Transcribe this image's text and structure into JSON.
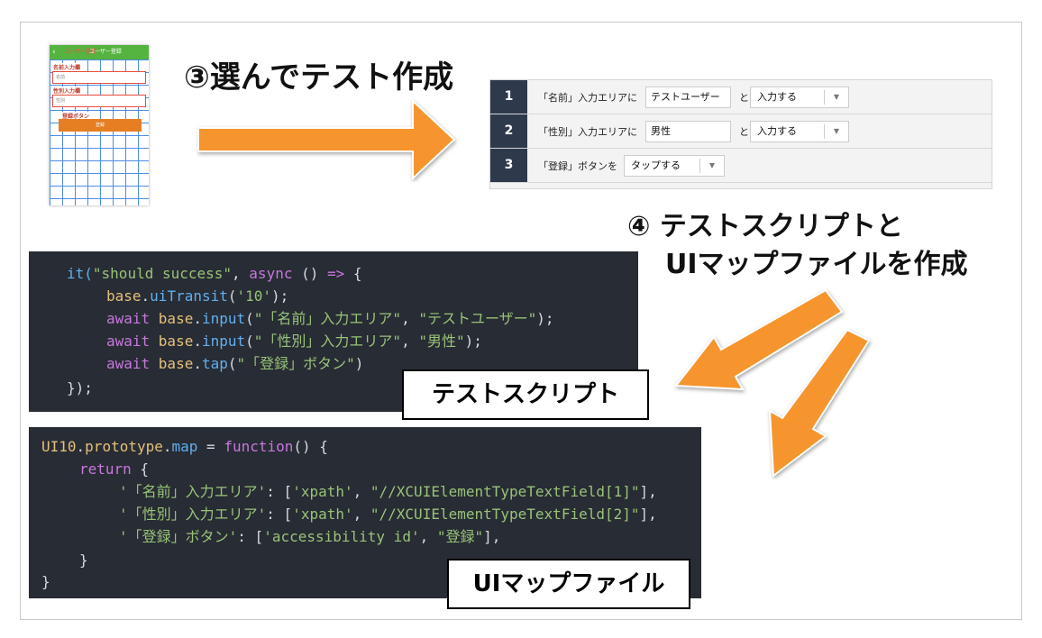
{
  "colors": {
    "arrow": "#f6952e",
    "code_bg": "#282c34",
    "phone_nav": "#55b33f",
    "step_number_bg": "#2e3a4c"
  },
  "phone": {
    "back": "‹",
    "nav_title": "ユーザー登録",
    "nav_sub": "ユーザー登録",
    "name_label": "名前入力欄",
    "name_placeholder": "名前",
    "gender_label": "性別入力欄",
    "gender_placeholder": "性別",
    "register_label": "登録ボタン",
    "register_button": "登録"
  },
  "heading_select": "③選んでテスト作成",
  "heading_create_line1": "④ テストスクリプトと",
  "heading_create_line2": "UIマップファイルを作成",
  "steps": [
    {
      "number": "1",
      "prefix": "「名前」入力エリアに",
      "value": "テストユーザー",
      "conj": "と",
      "action": "入力する"
    },
    {
      "number": "2",
      "prefix": "「性別」入力エリアに",
      "value": "男性",
      "conj": "と",
      "action": "入力する"
    },
    {
      "number": "3",
      "prefix": "「登録」ボタンを",
      "value": "",
      "conj": "",
      "action": "タップする"
    }
  ],
  "script_code": {
    "l1_a": "it(",
    "l1_b": "\"should success\"",
    "l1_c": ", ",
    "l1_d": "async",
    "l1_e": " () ",
    "l1_f": "=>",
    "l1_g": " {",
    "l2_a": "base",
    "l2_b": ".",
    "l2_c": "uiTransit",
    "l2_d": "(",
    "l2_e": "'10'",
    "l2_f": ");",
    "l3_a": "await ",
    "l3_b": "base",
    "l3_c": ".",
    "l3_d": "input",
    "l3_e": "(",
    "l3_f": "\"「名前」入力エリア\"",
    "l3_g": ", ",
    "l3_h": "\"テストユーザー\"",
    "l3_i": ");",
    "l4_a": "await ",
    "l4_b": "base",
    "l4_c": ".",
    "l4_d": "input",
    "l4_e": "(",
    "l4_f": "\"「性別」入力エリア\"",
    "l4_g": ", ",
    "l4_h": "\"男性\"",
    "l4_i": ");",
    "l5_a": "await ",
    "l5_b": "base",
    "l5_c": ".",
    "l5_d": "tap",
    "l5_e": "(",
    "l5_f": "\"「登録」ボタン\"",
    "l5_g": ")",
    "l6": "});"
  },
  "script_label": "テストスクリプト",
  "map_code": {
    "l1_a": "UI10",
    "l1_b": ".",
    "l1_c": "prototype",
    "l1_d": ".",
    "l1_e": "map",
    "l1_f": " = ",
    "l1_g": "function",
    "l1_h": "() {",
    "l2_a": "return",
    "l2_b": " {",
    "l3_a": "'「名前」入力エリア'",
    "l3_b": ": [",
    "l3_c": "'xpath'",
    "l3_d": ", ",
    "l3_e": "\"//XCUIElementTypeTextField[1]\"",
    "l3_f": "],",
    "l4_a": "'「性別」入力エリア'",
    "l4_b": ": [",
    "l4_c": "'xpath'",
    "l4_d": ", ",
    "l4_e": "\"//XCUIElementTypeTextField[2]\"",
    "l4_f": "],",
    "l5_a": "'「登録」ボタン'",
    "l5_b": ": [",
    "l5_c": "'accessibility id'",
    "l5_d": ", ",
    "l5_e": "\"登録\"",
    "l5_f": "],",
    "l6": "}",
    "l7": "}"
  },
  "map_label": "UIマップファイル"
}
